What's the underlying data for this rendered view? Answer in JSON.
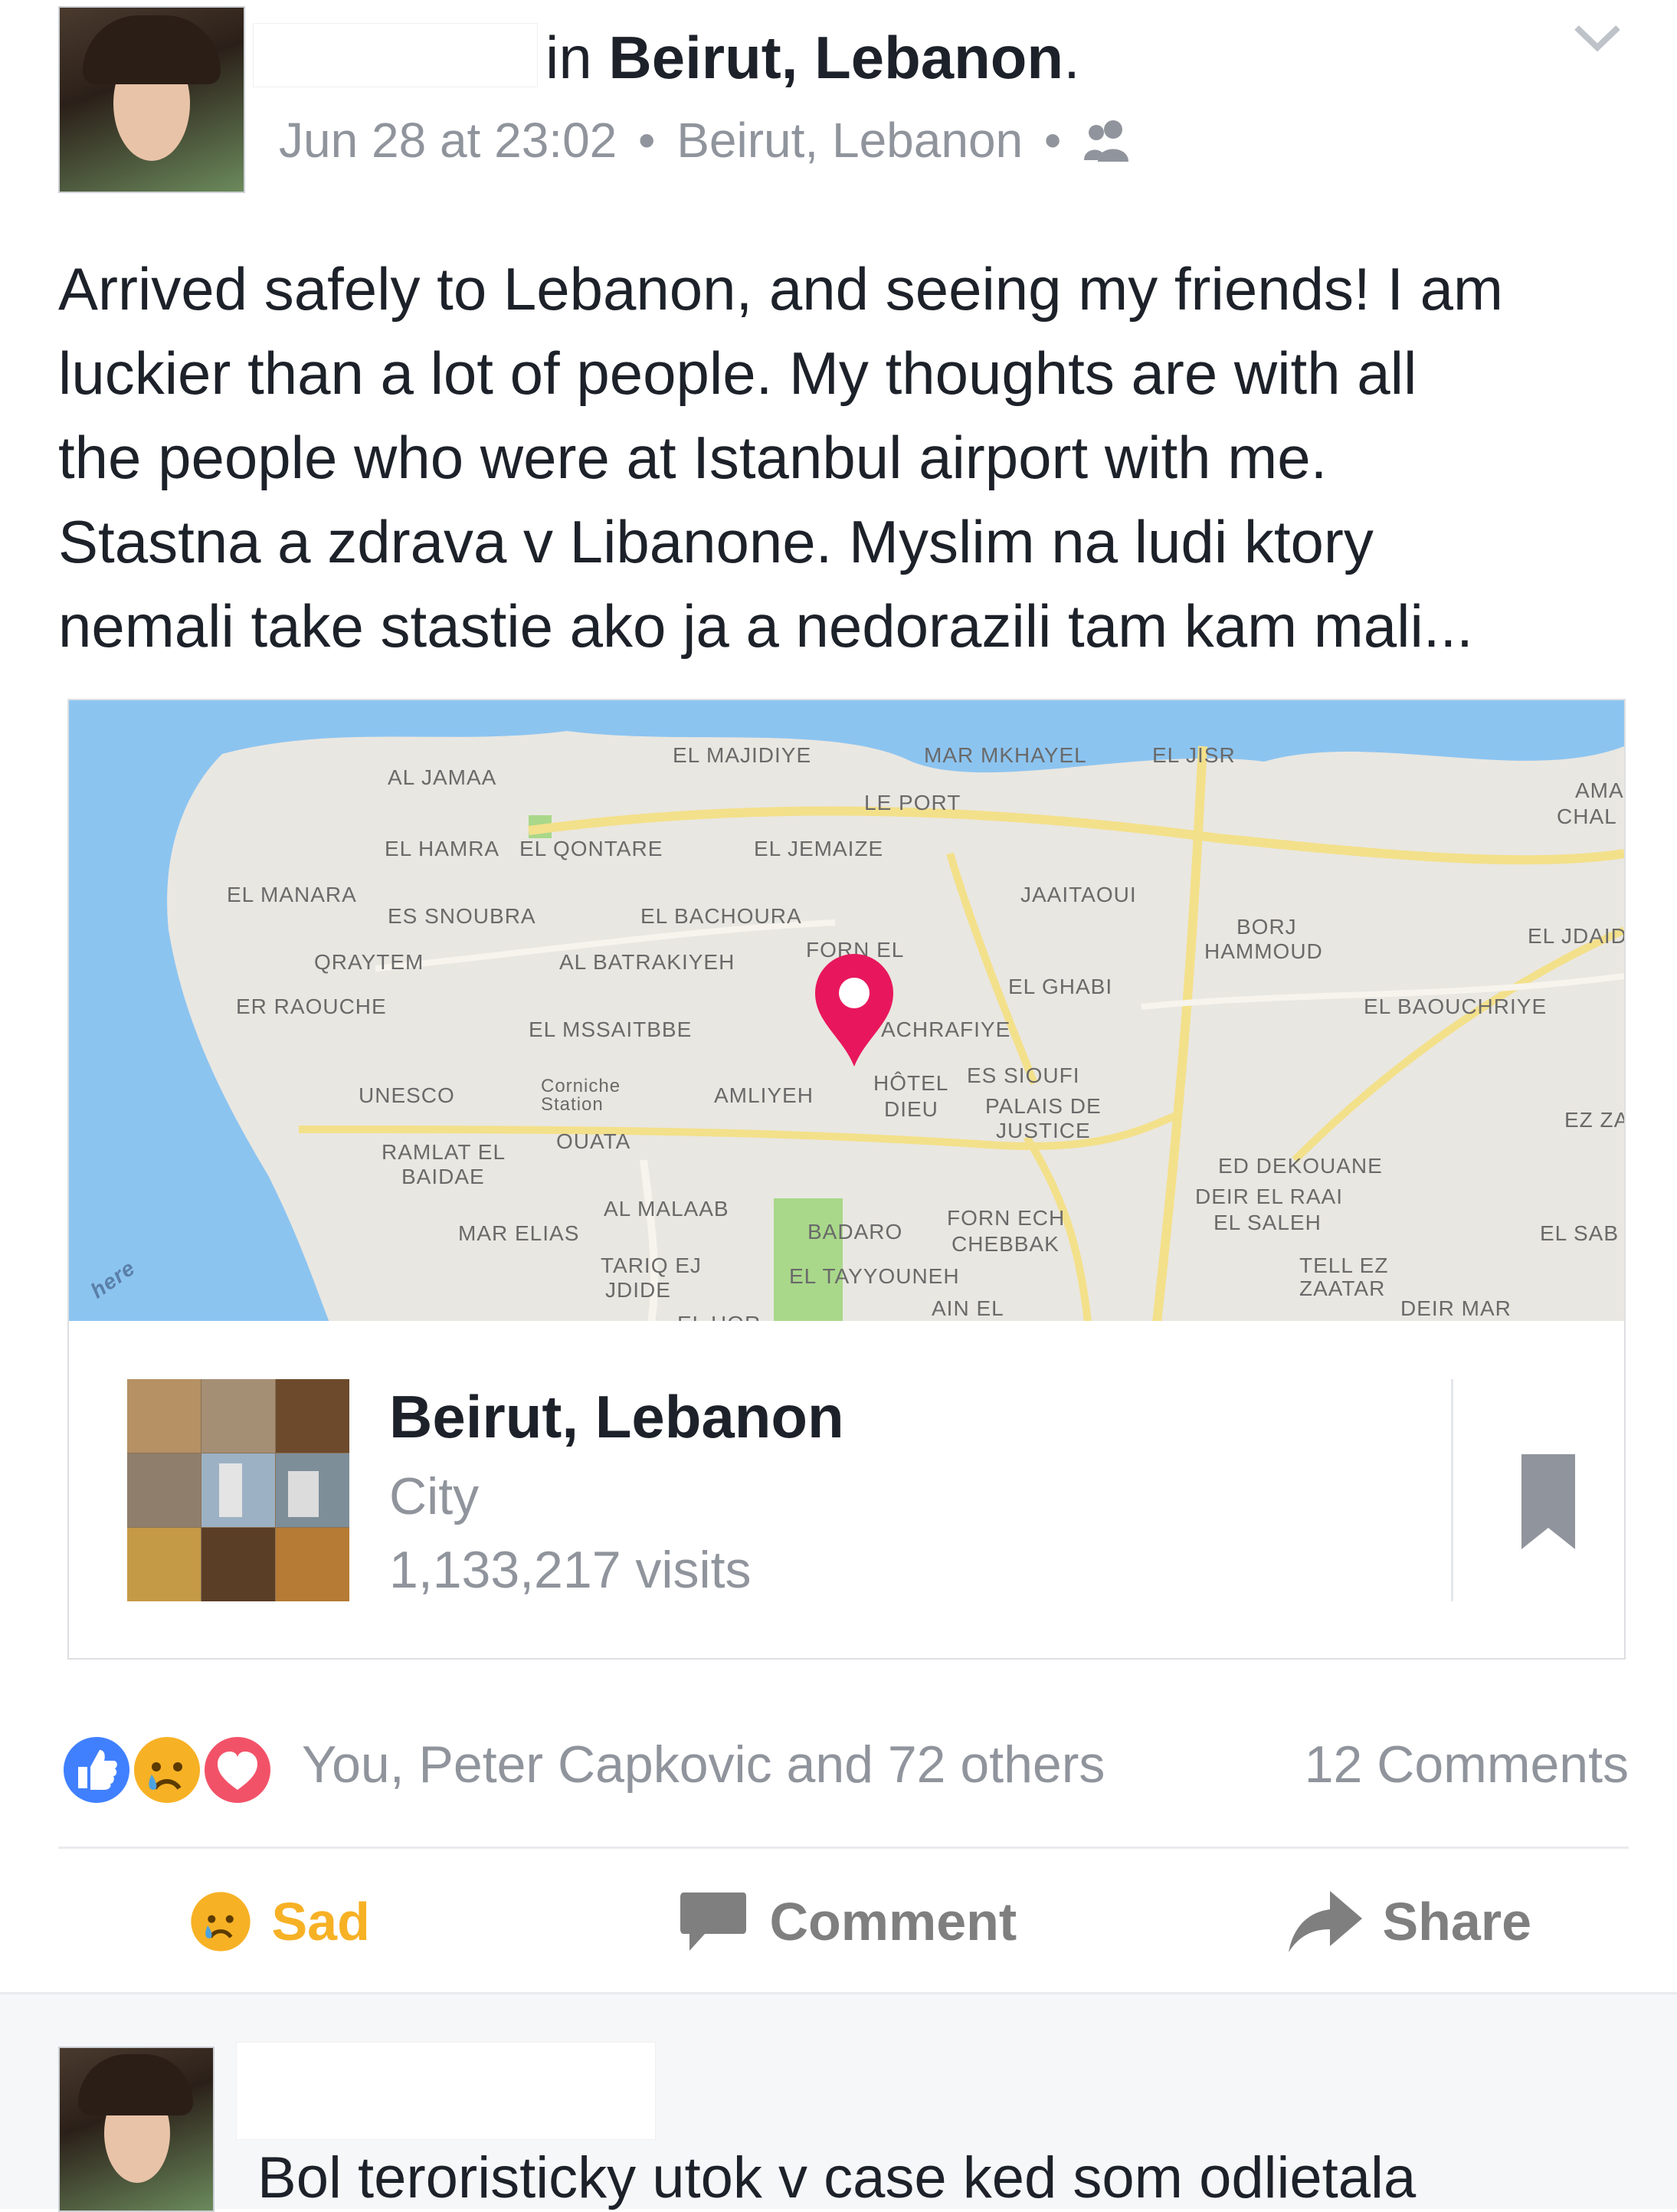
{
  "post": {
    "location_prefix": "in",
    "location": "Beirut, Lebanon",
    "location_suffix": ".",
    "timestamp": "Jun 28 at 23:02",
    "separator": "•",
    "meta_location": "Beirut, Lebanon",
    "audience_icon": "friends-icon",
    "text_lines": [
      "Arrived safely to Lebanon, and seeing my friends! I am",
      "luckier than a lot of people. My thoughts are with all",
      "the people who were at Istanbul airport with me.",
      "Stastna a zdrava v Libanone. Myslim na ludi ktory",
      "nemali take stastie ako ja a nedorazili tam kam mali..."
    ]
  },
  "map": {
    "watermark": "here",
    "labels": [
      "AL JAMAA",
      "EL MAJIDIYE",
      "MAR MKHAYEL",
      "EL JISR",
      "LE PORT",
      "AMA",
      "CHAL",
      "EL HAMRA",
      "EL QONTARE",
      "EL JEMAIZE",
      "EL MANARA",
      "ES SNOUBRA",
      "EL BACHOURA",
      "JAAITAOUI",
      "BORJ",
      "HAMMOUD",
      "EL JDAID",
      "QRAYTEM",
      "AL BATRAKIYEH",
      "FORN EL",
      "EL GHABI",
      "ER RAOUCHE",
      "EL MSSAITBBE",
      "ACHRAFIYE",
      "EL BAOUCHRIYE",
      "UNESCO",
      "Corniche",
      "Station",
      "AMLIYEH",
      "HÔTEL",
      "DIEU",
      "ES SIOUFI",
      "PALAIS DE",
      "JUSTICE",
      "EZ ZA",
      "RAMLAT EL",
      "BAIDAE",
      "OUATA",
      "ED DEKOUANE",
      "DEIR EL RAAI",
      "EL SALEH",
      "AL MALAAB",
      "MAR ELIAS",
      "BADARO",
      "FORN ECH",
      "CHEBBAK",
      "EL SAB",
      "TARIQ EJ",
      "JDIDE",
      "EL TAYYOUNEH",
      "TELL EZ",
      "ZAATAR",
      "DEIR MAR",
      "AIN EL",
      "EL HOR"
    ]
  },
  "place": {
    "name": "Beirut, Lebanon",
    "category": "City",
    "visits": "1,133,217 visits",
    "save_icon": "bookmark-icon"
  },
  "reactions": {
    "icons": [
      "like-icon",
      "sad-icon",
      "love-icon"
    ],
    "summary": "You, Peter Capkovic and 72 others",
    "comments_count": "12 Comments"
  },
  "actions": {
    "sad_label": "Sad",
    "comment_label": "Comment",
    "share_label": "Share"
  },
  "comment": {
    "text": "Bol teroristicky utok v case ked som odlietala"
  },
  "colors": {
    "sad_yellow": "#f7b125",
    "like_blue": "#4080ff",
    "love_red": "#f25268",
    "pin": "#e8175d",
    "water": "#8cc4f0"
  }
}
